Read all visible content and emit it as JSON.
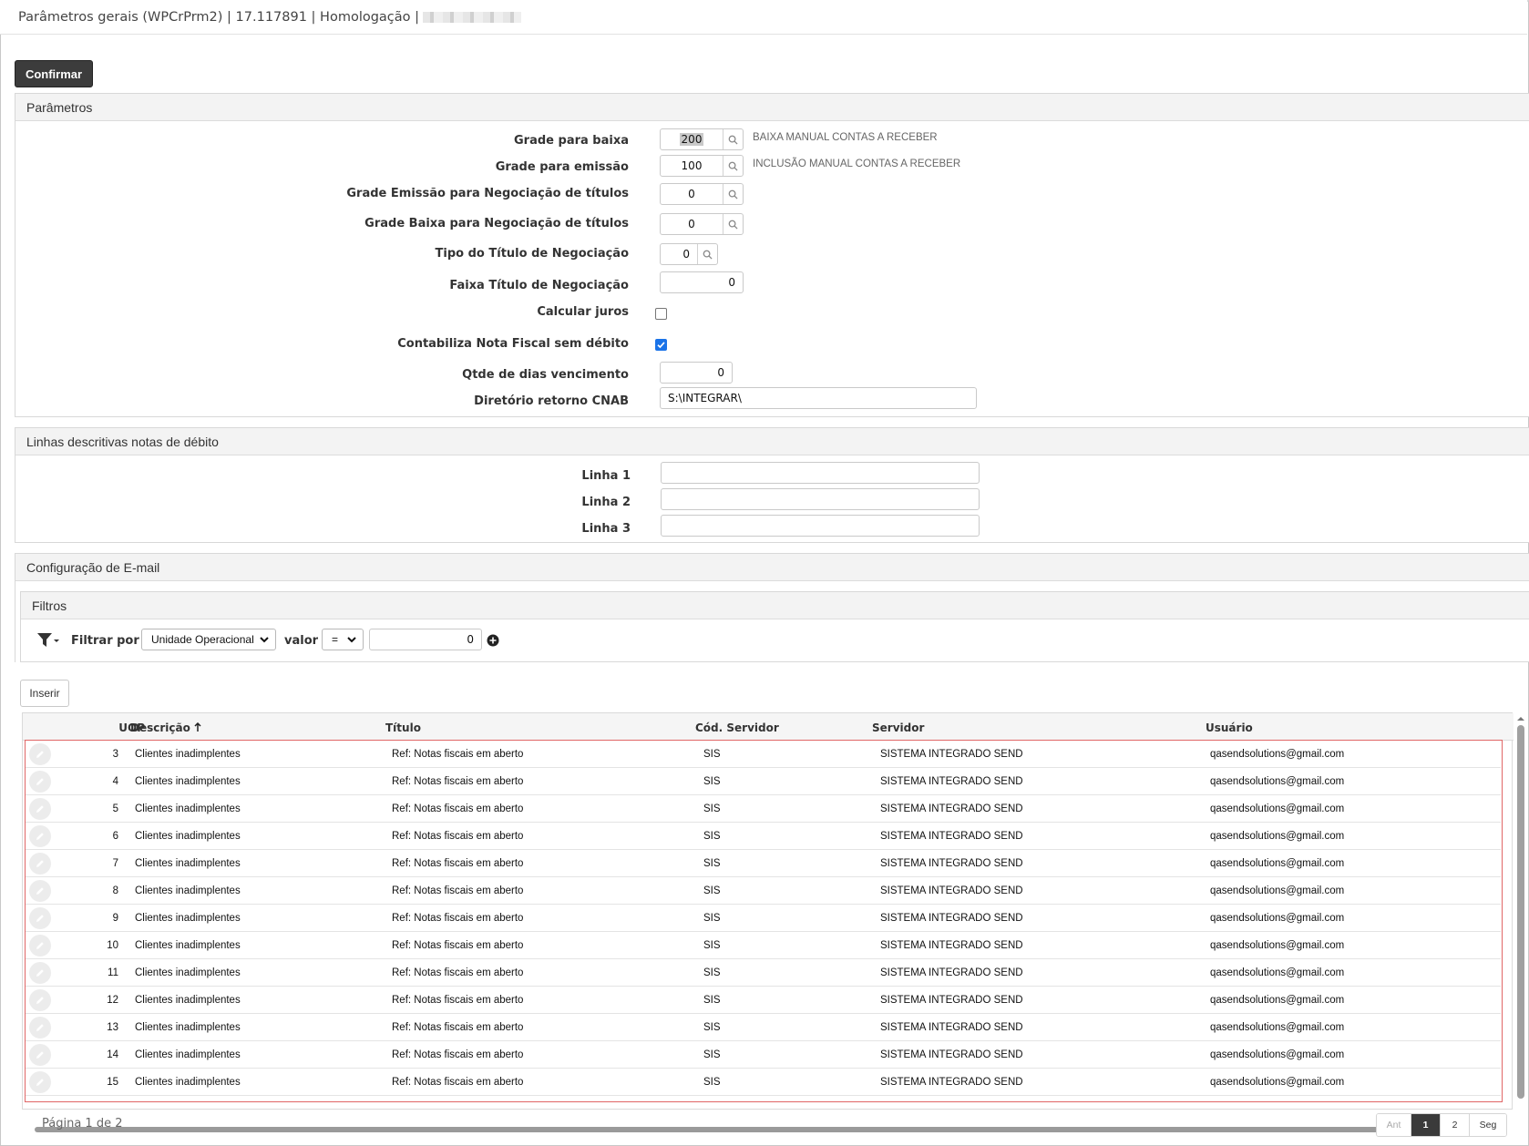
{
  "window": {
    "title": "Parâmetros gerais (WPCrPrm2) | 17.117891 | Homologação |"
  },
  "toolbar": {
    "confirm_label": "Confirmar"
  },
  "parametros": {
    "heading": "Parâmetros",
    "grade_baixa": {
      "label": "Grade para baixa",
      "value": "200",
      "hint": "BAIXA MANUAL CONTAS A RECEBER"
    },
    "grade_emissao": {
      "label": "Grade para emissão",
      "value": "100",
      "hint": "INCLUSÃO MANUAL CONTAS A RECEBER"
    },
    "grade_emissao_neg": {
      "label": "Grade Emissão para Negociação de títulos",
      "value": "0"
    },
    "grade_baixa_neg": {
      "label": "Grade Baixa para Negociação de títulos",
      "value": "0"
    },
    "tipo_titulo": {
      "label": "Tipo do Título de Negociação",
      "value": "0"
    },
    "faixa_titulo": {
      "label": "Faixa Título de Negociação",
      "value": "0"
    },
    "calcular_juros": {
      "label": "Calcular juros",
      "checked": false
    },
    "contabiliza_nf": {
      "label": "Contabiliza Nota Fiscal sem débito",
      "checked": true
    },
    "qtde_dias": {
      "label": "Qtde de dias vencimento",
      "value": "0"
    },
    "diretorio_cnab": {
      "label": "Diretório retorno CNAB",
      "value": "S:\\INTEGRAR\\"
    }
  },
  "linhas": {
    "heading": "Linhas descritivas notas de débito",
    "linha1": {
      "label": "Linha 1",
      "value": ""
    },
    "linha2": {
      "label": "Linha 2",
      "value": ""
    },
    "linha3": {
      "label": "Linha 3",
      "value": ""
    }
  },
  "email": {
    "heading": "Configuração de E-mail",
    "filtros": {
      "heading": "Filtros",
      "filtrar_por_label": "Filtrar por",
      "filtrar_por_value": "Unidade Operacional",
      "valor_label": "valor",
      "operator": "=",
      "valor": "0"
    },
    "insert_label": "Inserir",
    "columns": [
      "UOP",
      "Descrição",
      "Título",
      "Cód. Servidor",
      "Servidor",
      "Usuário"
    ],
    "rows": [
      {
        "uop": "3",
        "descricao": "Clientes inadimplentes",
        "titulo": "Ref: Notas fiscais em aberto",
        "cod": "SIS",
        "servidor": "SISTEMA INTEGRADO SEND",
        "usuario": "qasendsolutions@gmail.com"
      },
      {
        "uop": "4",
        "descricao": "Clientes inadimplentes",
        "titulo": "Ref: Notas fiscais em aberto",
        "cod": "SIS",
        "servidor": "SISTEMA INTEGRADO SEND",
        "usuario": "qasendsolutions@gmail.com"
      },
      {
        "uop": "5",
        "descricao": "Clientes inadimplentes",
        "titulo": "Ref: Notas fiscais em aberto",
        "cod": "SIS",
        "servidor": "SISTEMA INTEGRADO SEND",
        "usuario": "qasendsolutions@gmail.com"
      },
      {
        "uop": "6",
        "descricao": "Clientes inadimplentes",
        "titulo": "Ref: Notas fiscais em aberto",
        "cod": "SIS",
        "servidor": "SISTEMA INTEGRADO SEND",
        "usuario": "qasendsolutions@gmail.com"
      },
      {
        "uop": "7",
        "descricao": "Clientes inadimplentes",
        "titulo": "Ref: Notas fiscais em aberto",
        "cod": "SIS",
        "servidor": "SISTEMA INTEGRADO SEND",
        "usuario": "qasendsolutions@gmail.com"
      },
      {
        "uop": "8",
        "descricao": "Clientes inadimplentes",
        "titulo": "Ref: Notas fiscais em aberto",
        "cod": "SIS",
        "servidor": "SISTEMA INTEGRADO SEND",
        "usuario": "qasendsolutions@gmail.com"
      },
      {
        "uop": "9",
        "descricao": "Clientes inadimplentes",
        "titulo": "Ref: Notas fiscais em aberto",
        "cod": "SIS",
        "servidor": "SISTEMA INTEGRADO SEND",
        "usuario": "qasendsolutions@gmail.com"
      },
      {
        "uop": "10",
        "descricao": "Clientes inadimplentes",
        "titulo": "Ref: Notas fiscais em aberto",
        "cod": "SIS",
        "servidor": "SISTEMA INTEGRADO SEND",
        "usuario": "qasendsolutions@gmail.com"
      },
      {
        "uop": "11",
        "descricao": "Clientes inadimplentes",
        "titulo": "Ref: Notas fiscais em aberto",
        "cod": "SIS",
        "servidor": "SISTEMA INTEGRADO SEND",
        "usuario": "qasendsolutions@gmail.com"
      },
      {
        "uop": "12",
        "descricao": "Clientes inadimplentes",
        "titulo": "Ref: Notas fiscais em aberto",
        "cod": "SIS",
        "servidor": "SISTEMA INTEGRADO SEND",
        "usuario": "qasendsolutions@gmail.com"
      },
      {
        "uop": "13",
        "descricao": "Clientes inadimplentes",
        "titulo": "Ref: Notas fiscais em aberto",
        "cod": "SIS",
        "servidor": "SISTEMA INTEGRADO SEND",
        "usuario": "qasendsolutions@gmail.com"
      },
      {
        "uop": "14",
        "descricao": "Clientes inadimplentes",
        "titulo": "Ref: Notas fiscais em aberto",
        "cod": "SIS",
        "servidor": "SISTEMA INTEGRADO SEND",
        "usuario": "qasendsolutions@gmail.com"
      },
      {
        "uop": "15",
        "descricao": "Clientes inadimplentes",
        "titulo": "Ref: Notas fiscais em aberto",
        "cod": "SIS",
        "servidor": "SISTEMA INTEGRADO SEND",
        "usuario": "qasendsolutions@gmail.com"
      }
    ],
    "pager": {
      "summary": "Página 1 de 2",
      "prev": "Ant",
      "pages": [
        "1",
        "2"
      ],
      "next": "Seg"
    }
  },
  "icons": {
    "lookup": "magnifier-icon",
    "filter": "filter-funnel-icon",
    "add": "plus-circle-icon",
    "edit": "pencil-icon",
    "sort": "arrow-up-icon"
  },
  "colors": {
    "confirm_bg": "#3c3c3c",
    "checkbox_on": "#1a73e8",
    "rows_highlight": "#e06666",
    "pager_active": "#3a3a3a"
  }
}
